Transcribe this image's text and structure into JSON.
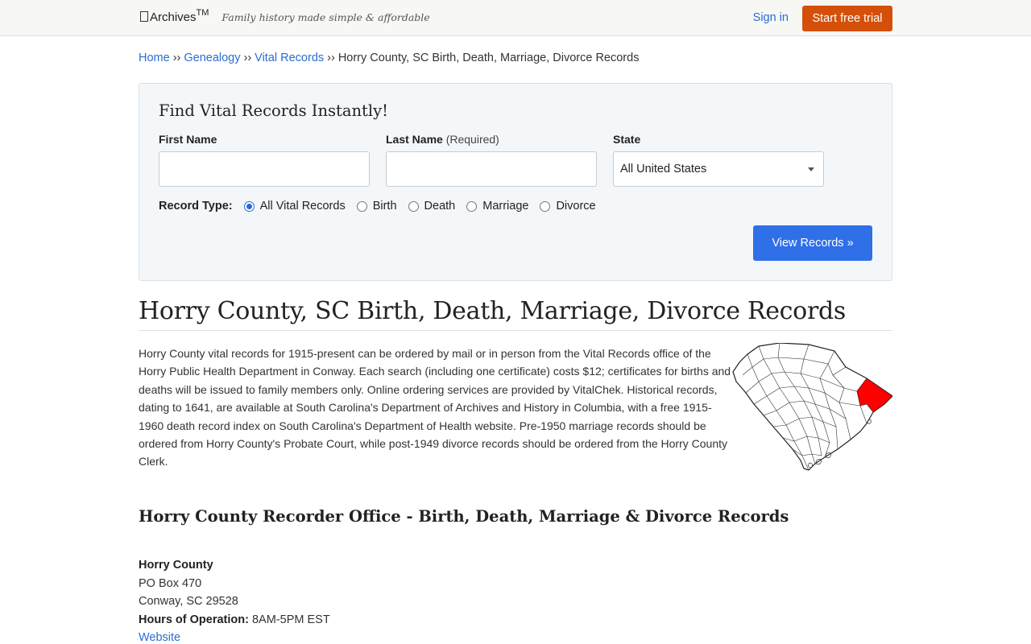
{
  "header": {
    "logo_text": "Archives",
    "logo_tm": "TM",
    "tagline": "Family history made simple & affordable",
    "signin_label": "Sign in",
    "trial_label": "Start free trial"
  },
  "breadcrumb": {
    "items": [
      "Home",
      "Genealogy",
      "Vital Records"
    ],
    "separator": "››",
    "current": "Horry County, SC Birth, Death, Marriage, Divorce Records"
  },
  "search": {
    "title": "Find Vital Records Instantly!",
    "first_name_label": "First Name",
    "last_name_label": "Last Name",
    "last_name_required": "(Required)",
    "state_label": "State",
    "state_value": "All United States",
    "record_type_label": "Record Type:",
    "record_types": [
      "All Vital Records",
      "Birth",
      "Death",
      "Marriage",
      "Divorce"
    ],
    "selected_record_type": "All Vital Records",
    "submit_label": "View Records »"
  },
  "main": {
    "title": "Horry County, SC Birth, Death, Marriage, Divorce Records",
    "description": "Horry County vital records for 1915-present can be ordered by mail or in person from the Vital Records office of the Horry Public Health Department in Conway. Each search (including one certificate) costs $12; certificates for births and deaths will be issued to family members only. Online ordering services are provided by VitalChek. Historical records, dating to 1641, are available at South Carolina's Department of Archives and History in Columbia, with a free 1915-1960 death record index on South Carolina's Department of Health website. Pre-1950 marriage records should be ordered from Horry County's Probate Court, while post-1949 divorce records should be ordered from the Horry County Clerk.",
    "map_highlight_color": "#ff0000"
  },
  "office": {
    "title": "Horry County Recorder Office - Birth, Death, Marriage & Divorce Records",
    "name": "Horry County",
    "address_line1": "PO Box 470",
    "address_line2": "Conway, SC 29528",
    "hours_label": "Hours of Operation:",
    "hours_value": "8AM-5PM EST",
    "website_label": "Website"
  }
}
